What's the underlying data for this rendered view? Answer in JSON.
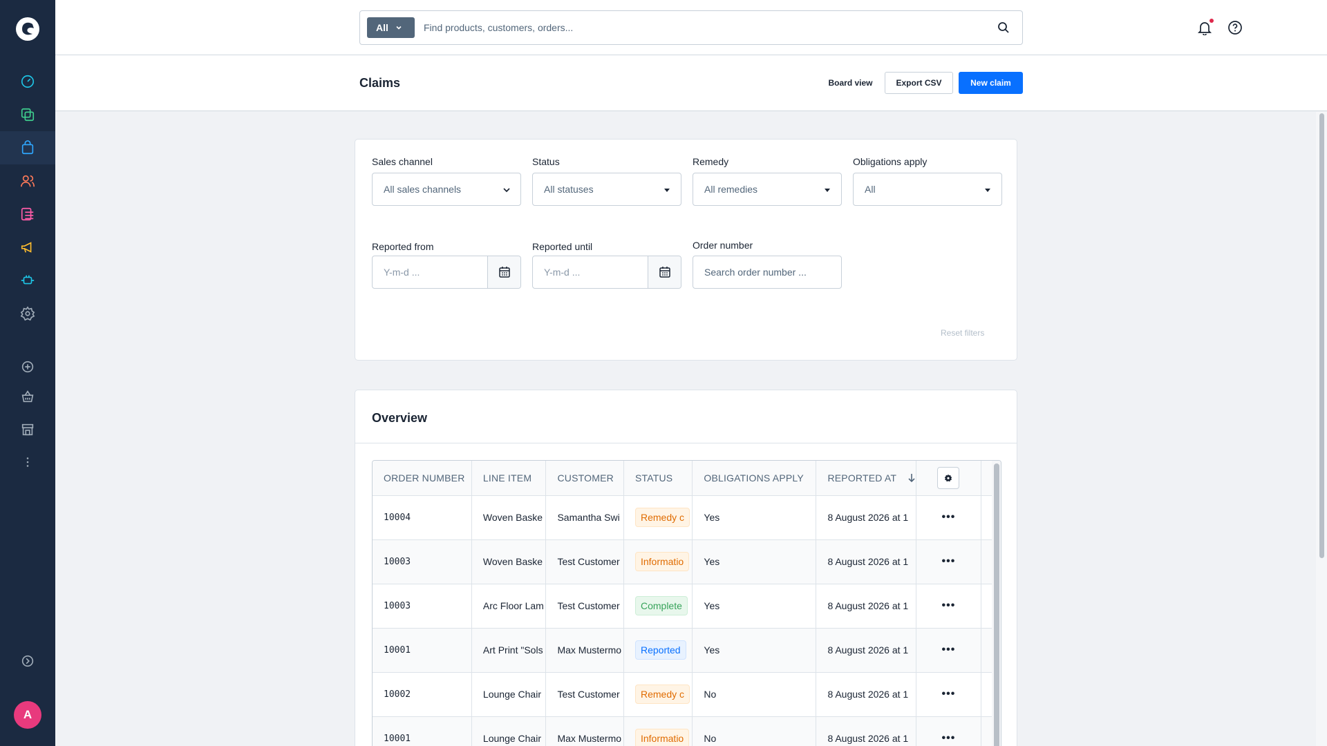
{
  "search": {
    "scope_label": "All",
    "placeholder": "Find products, customers, orders..."
  },
  "header": {
    "title": "Claims",
    "board_view_label": "Board view",
    "export_label": "Export CSV",
    "new_claim_label": "New claim"
  },
  "user": {
    "avatar_initial": "A"
  },
  "sidebar": {
    "icons": [
      "dashboard-icon",
      "catalogues-icon",
      "orders-icon",
      "customers-icon",
      "content-icon",
      "marketing-icon",
      "extensions-icon",
      "settings-icon",
      "add-sales-channel-icon",
      "storefront-basket-icon",
      "store-icon",
      "more-icon",
      "collapse-sidebar-icon"
    ]
  },
  "filters": {
    "sales_channel": {
      "label": "Sales channel",
      "value": "All sales channels"
    },
    "status": {
      "label": "Status",
      "value": "All statuses"
    },
    "remedy": {
      "label": "Remedy",
      "value": "All remedies"
    },
    "obligations": {
      "label": "Obligations apply",
      "value": "All"
    },
    "reported_from": {
      "label": "Reported from",
      "placeholder": "Y-m-d ..."
    },
    "reported_until": {
      "label": "Reported until",
      "placeholder": "Y-m-d ..."
    },
    "order_number": {
      "label": "Order number",
      "placeholder": "Search order number ..."
    },
    "reset_label": "Reset filters"
  },
  "overview": {
    "title": "Overview",
    "columns": [
      "Order number",
      "Line item",
      "Customer",
      "Status",
      "Obligations apply",
      "Reported at"
    ],
    "rows": [
      {
        "order": "10004",
        "item": "Woven Baske",
        "customer": "Samantha Swi",
        "status": "Remedy c",
        "status_color": "orange",
        "obligations": "Yes",
        "reported": "8 August 2026 at 1"
      },
      {
        "order": "10003",
        "item": "Woven Baske",
        "customer": "Test Customer",
        "status": "Informatio",
        "status_color": "orange",
        "obligations": "Yes",
        "reported": "8 August 2026 at 1"
      },
      {
        "order": "10003",
        "item": "Arc Floor Lam",
        "customer": "Test Customer",
        "status": "Complete",
        "status_color": "green",
        "obligations": "Yes",
        "reported": "8 August 2026 at 1"
      },
      {
        "order": "10001",
        "item": "Art Print \"Sols",
        "customer": "Max Mustermo",
        "status": "Reported",
        "status_color": "blue",
        "obligations": "Yes",
        "reported": "8 August 2026 at 1"
      },
      {
        "order": "10002",
        "item": "Lounge Chair",
        "customer": "Test Customer",
        "status": "Remedy c",
        "status_color": "orange",
        "obligations": "No",
        "reported": "8 August 2026 at 1"
      },
      {
        "order": "10001",
        "item": "Lounge Chair",
        "customer": "Max Mustermo",
        "status": "Informatio",
        "status_color": "orange",
        "obligations": "No",
        "reported": "8 August 2026 at 1"
      }
    ],
    "row_action_label": "•••"
  }
}
